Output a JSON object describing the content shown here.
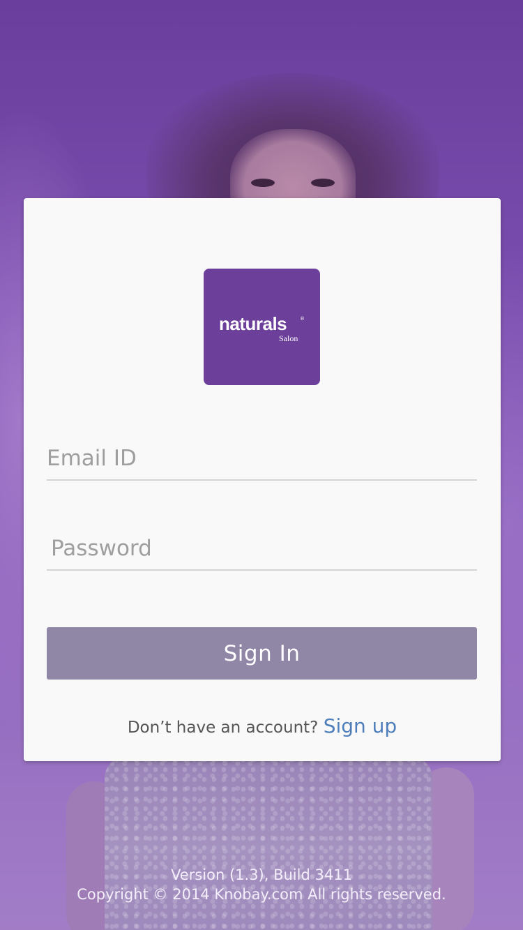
{
  "brand": {
    "logo_word": "naturals",
    "logo_reg": "®",
    "logo_sub": "Salon",
    "logo_color": "#6b3f9a"
  },
  "form": {
    "email": {
      "placeholder": "Email ID",
      "value": ""
    },
    "password": {
      "placeholder": "Password",
      "value": ""
    },
    "signin_label": "Sign In",
    "signin_color": "#9086a6"
  },
  "signup": {
    "prompt": "Don’t have an account?",
    "link": "Sign up",
    "link_color": "#4f7fba"
  },
  "footer": {
    "version": "Version (1.3), Build 3411",
    "copyright": "Copyright © 2014 Knobay.com All rights reserved."
  },
  "theme": {
    "background": "#7b4fb0",
    "card": "#f9f9f9"
  }
}
